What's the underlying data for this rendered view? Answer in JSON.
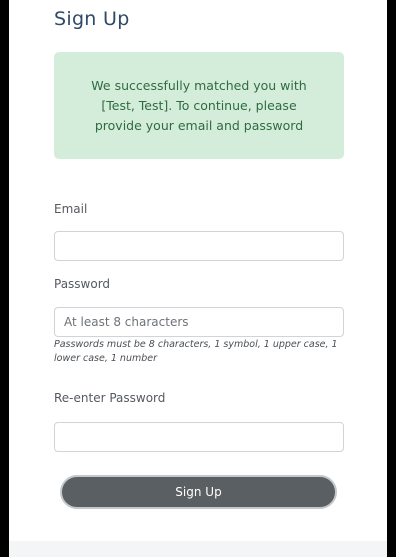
{
  "page": {
    "title": "Sign Up"
  },
  "alert": {
    "message": "We successfully matched you with [Test, Test]. To continue, please provide your email and password"
  },
  "form": {
    "email_label": "Email",
    "email_value": "",
    "password_label": "Password",
    "password_placeholder": "At least 8 characters",
    "password_hint": "Passwords must be 8 characters, 1 symbol, 1 upper case, 1 lower case, 1 number",
    "reenter_label": "Re-enter Password",
    "reenter_value": "",
    "submit_label": "Sign Up"
  },
  "colors": {
    "title": "#2e4a66",
    "alert_bg": "#d4eddb",
    "alert_text": "#2f6b3f",
    "button_bg": "#5a5f63"
  }
}
